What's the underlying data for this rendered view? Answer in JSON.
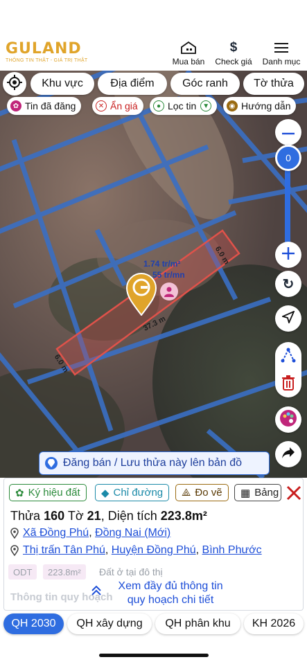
{
  "brand": {
    "name": "GULAND",
    "tagline": "THÔNG TIN THẬT - GIÁ TRỊ THẬT",
    "color": "#e0a42a"
  },
  "header": {
    "nav": [
      {
        "label": "Mua bán",
        "icon": "house-icon"
      },
      {
        "label": "Check giá",
        "icon": "dollar-icon"
      },
      {
        "label": "Danh mục",
        "icon": "menu-icon"
      }
    ]
  },
  "filters": {
    "pills": [
      "Khu vực",
      "Địa điểm",
      "Góc ranh",
      "Tờ thửa"
    ],
    "chips": [
      {
        "label": "Tin đã đăng",
        "icon": "palette-icon"
      },
      {
        "label": "Ẩn giá",
        "icon": "hide-price-icon"
      },
      {
        "label": "Lọc tin",
        "icon": "filter-pin-icon"
      },
      {
        "label": "Hướng dẫn",
        "icon": "guide-icon"
      }
    ]
  },
  "map": {
    "zoom_value": "0",
    "parcel_labels": {
      "price_per_m2": "1.74 tr/m²",
      "price_per_mn": "55 tr/mn",
      "area_short": "m²",
      "edge_top": "6.0 m",
      "edge_bottom": "6.0 m",
      "edge_long": "37.3 m"
    },
    "cta_label": "Đăng bán / Lưu thửa này lên bản đồ",
    "colors": {
      "parcel_outline": "#e0524a",
      "grid_lines": "#3a6fc4",
      "accent": "#2f6de0"
    }
  },
  "panel": {
    "tools": [
      {
        "label": "Ký hiệu đất",
        "icon": "palette-icon"
      },
      {
        "label": "Chỉ đường",
        "icon": "directions-icon"
      },
      {
        "label": "Đo vẽ",
        "icon": "measure-icon"
      },
      {
        "label": "Bảng",
        "icon": "table-icon"
      }
    ],
    "title": {
      "parcel_label": "Thửa",
      "parcel_no": "160",
      "sheet_label": "Tờ",
      "sheet_no": "21",
      "area_label": "Diện tích",
      "area_value": "223.8m²"
    },
    "address_new": {
      "commune": "Xã Đồng Phú",
      "province": "Đồng Nai (Mới)"
    },
    "address_old": {
      "town": "Thị trấn Tân Phú",
      "district": "Huyện Đồng Phú",
      "province": "Bình Phước"
    },
    "zoning": {
      "code": "ODT",
      "area": "223.8m²",
      "description": "Đất ở tại đô thị"
    },
    "faded_heading": "Thông tin quy hoạch",
    "more_label_1": "Xem đầy đủ thông tin",
    "more_label_2": "quy hoạch chi tiết"
  },
  "bottom_tabs": [
    {
      "label": "QH 2030",
      "active": true
    },
    {
      "label": "QH xây dựng",
      "active": false
    },
    {
      "label": "QH phân khu",
      "active": false
    },
    {
      "label": "KH 2026",
      "active": false
    }
  ]
}
